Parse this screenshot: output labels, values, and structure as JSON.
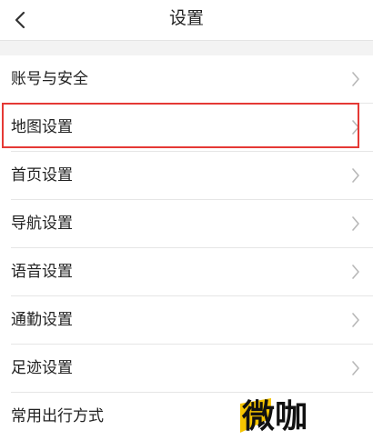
{
  "navbar": {
    "title": "设置",
    "back_icon": "chevron-left-icon"
  },
  "settings": {
    "items": [
      {
        "label": "账号与安全",
        "icon": "chevron-right-icon"
      },
      {
        "label": "地图设置",
        "icon": "chevron-right-icon",
        "highlighted": true
      },
      {
        "label": "首页设置",
        "icon": "chevron-right-icon"
      },
      {
        "label": "导航设置",
        "icon": "chevron-right-icon"
      },
      {
        "label": "语音设置",
        "icon": "chevron-right-icon"
      },
      {
        "label": "通勤设置",
        "icon": "chevron-right-icon"
      },
      {
        "label": "足迹设置",
        "icon": "chevron-right-icon"
      },
      {
        "label": "常用出行方式",
        "icon": "chevron-right-icon"
      }
    ]
  },
  "watermark": {
    "text": "微咖"
  },
  "colors": {
    "highlight": "#e53935",
    "chevron": "#b8b8b8",
    "watermark_accent": "#f5c400"
  }
}
